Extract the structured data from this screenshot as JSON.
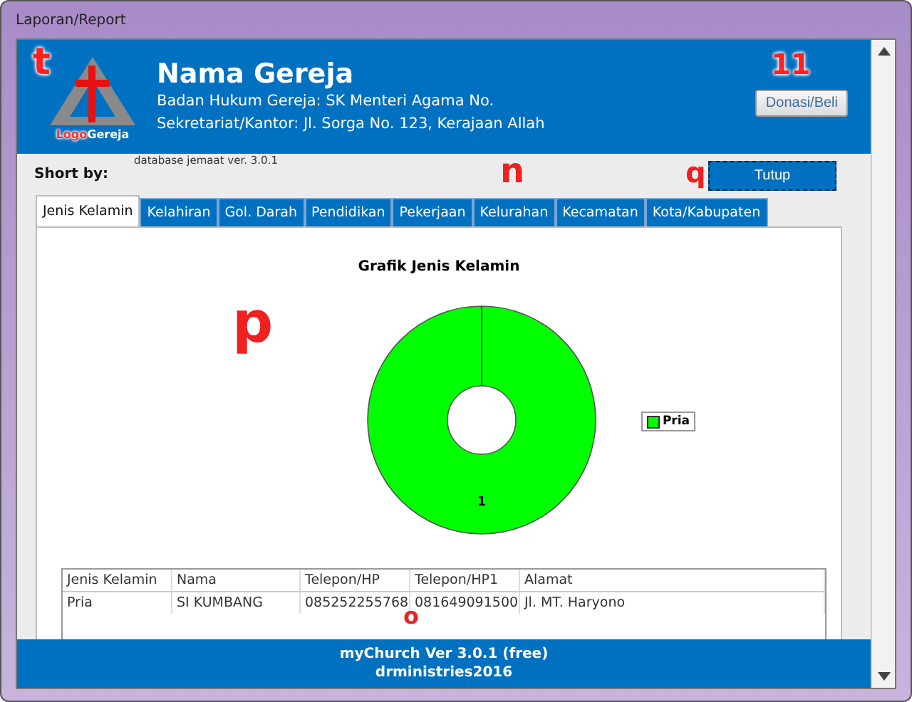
{
  "window": {
    "title": "Laporan/Report"
  },
  "header": {
    "logo_text": [
      "Logo",
      "Gereja"
    ],
    "church_name": "Nama Gereja",
    "legal": "Badan Hukum Gereja: SK Menteri Agama No.",
    "address": "Sekretariat/Kantor: Jl. Sorga No. 123, Kerajaan Allah",
    "donate_button": "Donasi/Beli"
  },
  "version_note": "database jemaat ver. 3.0.1",
  "sort_label": "Short by:",
  "close_button": "Tutup",
  "tabs": [
    {
      "label": "Jenis Kelamin",
      "selected": true
    },
    {
      "label": "Kelahiran",
      "selected": false
    },
    {
      "label": "Gol. Darah",
      "selected": false
    },
    {
      "label": "Pendidikan",
      "selected": false
    },
    {
      "label": "Pekerjaan",
      "selected": false
    },
    {
      "label": "Kelurahan",
      "selected": false
    },
    {
      "label": "Kecamatan",
      "selected": false
    },
    {
      "label": "Kota/Kabupaten",
      "selected": false
    }
  ],
  "chart_data": {
    "type": "donut",
    "title": "Grafik Jenis Kelamin",
    "categories": [
      "Pria"
    ],
    "values": [
      1
    ],
    "data_labels": true
  },
  "table": {
    "columns": [
      "Jenis Kelamin",
      "Nama",
      "Telepon/HP",
      "Telepon/HP1",
      "Alamat"
    ],
    "rows": [
      [
        "Pria",
        "SI KUMBANG",
        "085252255768",
        "081649091500",
        "Jl. MT. Haryono"
      ]
    ]
  },
  "footer": {
    "line_1": "myChurch Ver 3.0.1 (free)",
    "line_2": "drministries2016"
  },
  "annotations": [
    {
      "kind": "t",
      "label": "t"
    },
    {
      "kind": "num",
      "label": "11"
    },
    {
      "kind": "q",
      "label": "q"
    },
    {
      "kind": "n",
      "label": "n"
    },
    {
      "kind": "p",
      "label": "p"
    },
    {
      "kind": "o",
      "label": "o"
    }
  ]
}
